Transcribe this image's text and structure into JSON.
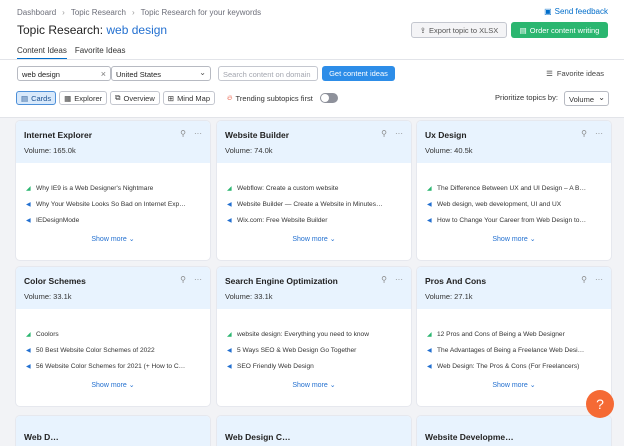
{
  "breadcrumb": [
    "Dashboard",
    "Topic Research",
    "Topic Research for your keywords"
  ],
  "feedback_label": "Send feedback",
  "title_prefix": "Topic Research:",
  "title_query": "web design",
  "export_label": "Export topic to XLSX",
  "order_label": "Order content writing",
  "tabs": [
    "Content Ideas",
    "Favorite Ideas"
  ],
  "search": {
    "value": "web design"
  },
  "country": {
    "value": "United States"
  },
  "domain": {
    "placeholder": "Search content on domain"
  },
  "get_ideas_label": "Get content ideas",
  "fav_ideas_label": "Favorite ideas",
  "views": [
    "Cards",
    "Explorer",
    "Overview",
    "Mind Map"
  ],
  "trending_label": "Trending subtopics first",
  "prioritize_label": "Prioritize topics by:",
  "prioritize_value": "Volume",
  "show_more": "Show more",
  "cards": [
    {
      "name": "Internet Explorer",
      "volume": "Volume: 165.0k",
      "items": [
        {
          "text": "Why IE9 is a Web Designer's Nightmare",
          "type": "green"
        },
        {
          "text": "Why Your Website Looks So Bad on Internet Exp…",
          "type": "blue"
        },
        {
          "text": "IEDesignMode",
          "type": "blue"
        }
      ]
    },
    {
      "name": "Website Builder",
      "volume": "Volume: 74.0k",
      "items": [
        {
          "text": "Webflow: Create a custom website",
          "type": "green"
        },
        {
          "text": "Website Builder — Create a Website in Minutes…",
          "type": "blue"
        },
        {
          "text": "Wix.com: Free Website Builder",
          "type": "blue"
        }
      ]
    },
    {
      "name": "Ux Design",
      "volume": "Volume: 40.5k",
      "items": [
        {
          "text": "The Difference Between UX and UI Design – A B…",
          "type": "green"
        },
        {
          "text": "Web design, web development, UI and UX",
          "type": "blue"
        },
        {
          "text": "How to Change Your Career from Web Design to…",
          "type": "blue"
        }
      ]
    },
    {
      "name": "Color Schemes",
      "volume": "Volume: 33.1k",
      "items": [
        {
          "text": "Coolors",
          "type": "green"
        },
        {
          "text": "50 Best Website Color Schemes of 2022",
          "type": "blue"
        },
        {
          "text": "56 Website Color Schemes for 2021 (+ How to C…",
          "type": "blue"
        }
      ]
    },
    {
      "name": "Search Engine Optimization",
      "volume": "Volume: 33.1k",
      "items": [
        {
          "text": "website design: Everything you need to know",
          "type": "green"
        },
        {
          "text": "5 Ways SEO & Web Design Go Together",
          "type": "blue"
        },
        {
          "text": "SEO Friendly Web Design",
          "type": "blue"
        }
      ]
    },
    {
      "name": "Pros And Cons",
      "volume": "Volume: 27.1k",
      "items": [
        {
          "text": "12 Pros and Cons of Being a Web Designer",
          "type": "green"
        },
        {
          "text": "The Advantages of Being a Freelance Web Desi…",
          "type": "blue"
        },
        {
          "text": "Web Design: The Pros & Cons (For Freelancers)",
          "type": "blue"
        }
      ]
    }
  ],
  "partial_cards": [
    "Web D…",
    "Web Design C…",
    "Website Developme…"
  ],
  "help_label": "?"
}
